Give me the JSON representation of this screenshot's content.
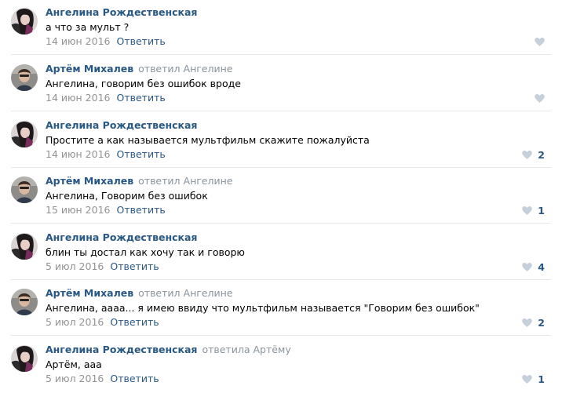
{
  "colors": {
    "link": "#2a5885",
    "muted": "#939393",
    "text": "#000000",
    "divider": "#e7e8ec",
    "like_icon": "#c5d0db"
  },
  "like_icon": "heart-icon",
  "reply_label": "Ответить",
  "comments": [
    {
      "avatar": "angelina",
      "author": "Ангелина Рождественская",
      "reply_word": "",
      "reply_target": "",
      "text": "а что за мульт ?",
      "date": "14 июн 2016",
      "likes": ""
    },
    {
      "avatar": "artem",
      "author": "Артём Михалев",
      "reply_word": "ответил",
      "reply_target": "Ангелине",
      "text": "Ангелина, говорим без ошибок вроде",
      "date": "14 июн 2016",
      "likes": ""
    },
    {
      "avatar": "angelina",
      "author": "Ангелина Рождественская",
      "reply_word": "",
      "reply_target": "",
      "text": "Простите а как называется мультфильм скажите пожалуйста",
      "date": "14 июн 2016",
      "likes": "2"
    },
    {
      "avatar": "artem",
      "author": "Артём Михалев",
      "reply_word": "ответил",
      "reply_target": "Ангелине",
      "text": "Ангелина, Говорим без ошибок",
      "date": "15 июн 2016",
      "likes": "1"
    },
    {
      "avatar": "angelina",
      "author": "Ангелина Рождественская",
      "reply_word": "",
      "reply_target": "",
      "text": "блин ты достал как хочу так и говорю",
      "date": "5 июл 2016",
      "likes": "4"
    },
    {
      "avatar": "artem",
      "author": "Артём Михалев",
      "reply_word": "ответил",
      "reply_target": "Ангелине",
      "text": "Ангелина, аааа... я имею ввиду что мультфильм называется \"Говорим без ошибок\"",
      "date": "5 июл 2016",
      "likes": "2"
    },
    {
      "avatar": "angelina",
      "author": "Ангелина Рождественская",
      "reply_word": "ответила",
      "reply_target": "Артёму",
      "text": "Артём, ааа",
      "date": "5 июл 2016",
      "likes": "1"
    }
  ]
}
